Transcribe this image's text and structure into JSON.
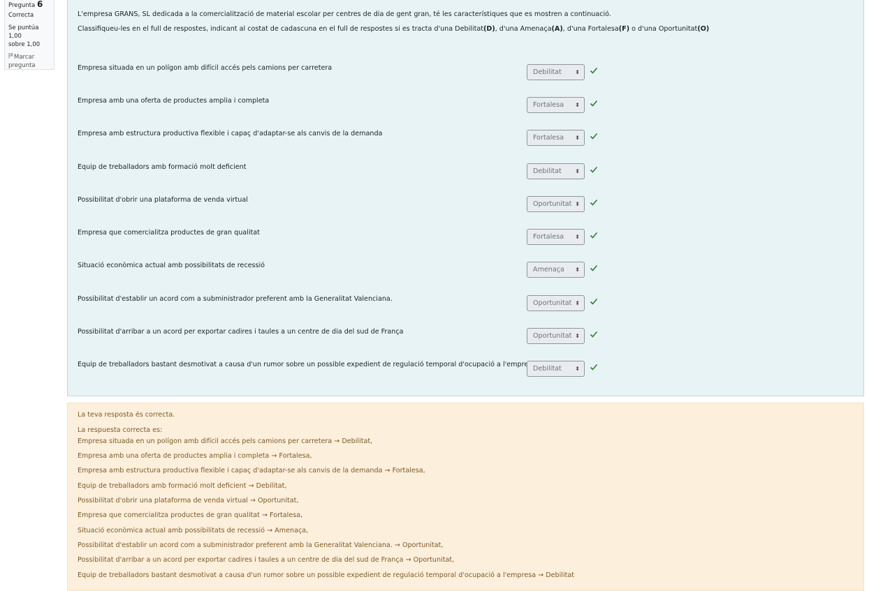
{
  "info": {
    "question_label": "Pregunta",
    "question_number": "6",
    "state": "Correcta",
    "grade_line1": "Se puntúa 1,00",
    "grade_line2": "sobre 1,00",
    "flag_line1": "Marcar",
    "flag_line2": "pregunta"
  },
  "question": {
    "intro": "L'empresa GRANS, SL dedicada a la comercialització de material escolar per centres de dia de gent gran, té les característiques que es mostren a continuació.",
    "instr_a": "Classifiqueu-les en el full de respostes, indicant al costat de cadascuna en el full de respostes si es tracta d'una Debilitat",
    "instr_d": "(D)",
    "instr_b": ", d'una Amenaça",
    "instr_am": "(A)",
    "instr_c": ", d'una Fortalesa",
    "instr_f": "(F)",
    "instr_e": " o d'una Oportunitat",
    "instr_o": "(O)",
    "items": [
      {
        "text": "Empresa situada en un polígon amb difícil accés pels camions per carretera",
        "answer": "Debilitat"
      },
      {
        "text": "Empresa amb una oferta de productes amplia i completa",
        "answer": "Fortalesa"
      },
      {
        "text": "Empresa amb estructura productiva flexible i capaç d'adaptar-se als canvis de la demanda",
        "answer": "Fortalesa"
      },
      {
        "text": "Equip de treballadors amb formació molt deficient",
        "answer": "Debilitat"
      },
      {
        "text": "Possibilitat d'obrir una plataforma de venda virtual",
        "answer": "Oportunitat"
      },
      {
        "text": "Empresa que comercialitza productes de gran qualitat",
        "answer": "Fortalesa"
      },
      {
        "text": "Situació econòmica actual amb possibilitats de recessió",
        "answer": "Amenaça"
      },
      {
        "text": "Possibilitat d'establir un acord com a subministrador preferent amb la Generalitat Valenciana.",
        "answer": "Oportunitat"
      },
      {
        "text": "Possibilitat d'arribar a un acord per exportar cadires i taules a un centre de dia del sud de França",
        "answer": "Oportunitat"
      },
      {
        "text": "Equip de treballadors bastant desmotivat a causa d'un rumor sobre un possible expedient de regulació temporal d'ocupació a l'empresa",
        "answer": "Debilitat"
      }
    ]
  },
  "feedback": {
    "correct_msg": "La teva resposta és correcta.",
    "right_answer_label": "La respuesta correcta es:",
    "lines": [
      "Empresa situada en un polígon amb difícil accés pels camions per carretera → Debilitat,",
      "Empresa amb una oferta de productes amplia i completa → Fortalesa,",
      "Empresa amb estructura productiva flexible i capaç d'adaptar-se als canvis de la demanda → Fortalesa,",
      "Equip de treballadors amb formació molt deficient → Debilitat,",
      "Possibilitat d'obrir una plataforma de venda virtual → Oportunitat,",
      "Empresa que comercialitza productes de gran qualitat → Fortalesa,",
      "Situació econòmica actual amb possibilitats de recessió → Amenaça,",
      "Possibilitat d'establir un acord com a subministrador preferent amb la Generalitat Valenciana. → Oportunitat,",
      "Possibilitat d'arribar a un acord per exportar cadires i taules a un centre de dia del sud de França → Oportunitat,",
      "Equip de treballadors bastant desmotivat a causa d'un rumor sobre un possible expedient de regulació temporal d'ocupació a l'empresa → Debilitat"
    ]
  },
  "colors": {
    "content_bg": "#e7f3f5",
    "feedback_bg": "#fcefdc",
    "feedback_text": "#7d5a29",
    "check": "#357a32"
  },
  "icons": {
    "check": "check-icon",
    "flag": "flag-icon",
    "select_arrows": "select-arrows-icon"
  }
}
